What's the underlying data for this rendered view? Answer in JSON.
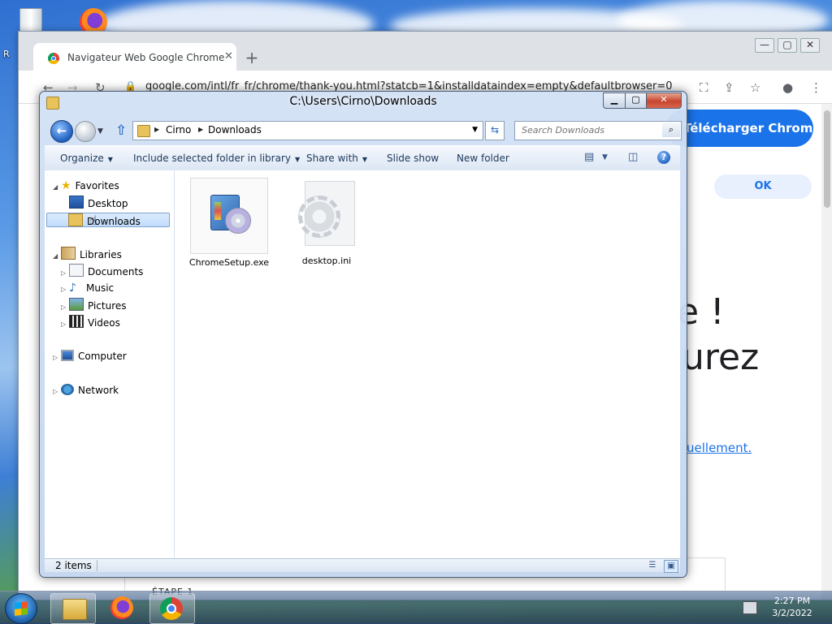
{
  "desktop": {
    "partial_label": "R"
  },
  "chrome": {
    "tab_title": "Navigateur Web Google Chrome",
    "tab_close": "✕",
    "new_tab": "+",
    "url": "google.com/intl/fr_fr/chrome/thank-you.html?statcb=1&installdataindex=empty&defaultbrowser=0",
    "download_button": "Télécharger Chrome",
    "ok_button": "OK",
    "partial_heading_1": "e !",
    "partial_heading_2": "urez",
    "partial_link": "uellement.",
    "step_label": "ÉTAPE 1"
  },
  "explorer": {
    "title": "C:\\Users\\Cirno\\Downloads",
    "breadcrumb": [
      "Cirno",
      "Downloads"
    ],
    "search_placeholder": "Search Downloads",
    "toolbar": {
      "organize": "Organize",
      "include_library": "Include selected folder in library",
      "share_with": "Share with",
      "slide_show": "Slide show",
      "new_folder": "New folder"
    },
    "nav": {
      "favorites": "Favorites",
      "desktop": "Desktop",
      "downloads": "Downloads",
      "libraries": "Libraries",
      "documents": "Documents",
      "music": "Music",
      "pictures": "Pictures",
      "videos": "Videos",
      "computer": "Computer",
      "network": "Network"
    },
    "files": [
      {
        "name": "ChromeSetup.exe",
        "icon": "installer-icon"
      },
      {
        "name": "desktop.ini",
        "icon": "settings-file-icon"
      }
    ],
    "status": "2 items"
  },
  "taskbar": {
    "time": "2:27 PM",
    "date": "3/2/2022"
  }
}
